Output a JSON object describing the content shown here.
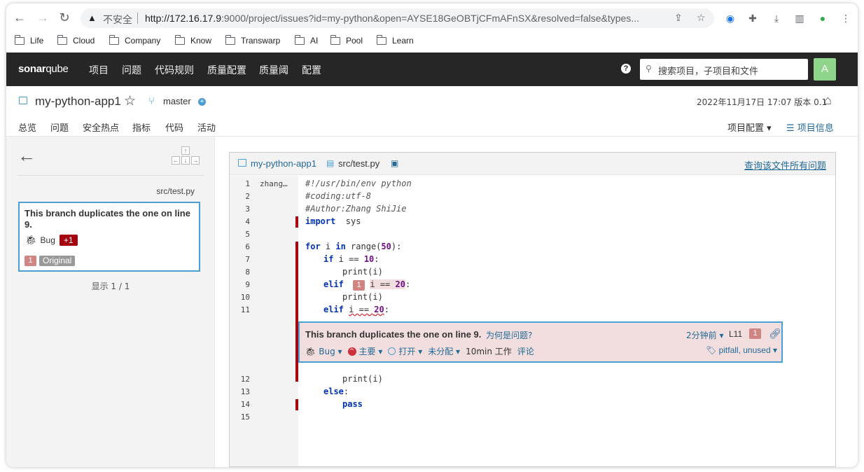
{
  "browser": {
    "insecure_label": "不安全",
    "url_host": "http://172.16.17.9",
    "url_rest": ":9000/project/issues?id=my-python&open=AYSE18GeOBTjCFmAFnSX&resolved=false&types...",
    "bookmarks": [
      "Life",
      "Cloud",
      "Company",
      "Know",
      "Transwarp",
      "AI",
      "Pool",
      "Learn"
    ]
  },
  "header": {
    "logo_bold": "sonar",
    "logo_light": "qube",
    "nav": [
      "项目",
      "问题",
      "代码规则",
      "质量配置",
      "质量阈",
      "配置"
    ],
    "help": "?",
    "search_placeholder": "搜索项目，子项目和文件",
    "avatar_letter": "A"
  },
  "project": {
    "name": "my-python-app1",
    "branch": "master",
    "branch_add": "+",
    "meta": "2022年11月17日 17:07   版本 0.1",
    "tabs": [
      "总览",
      "问题",
      "安全热点",
      "指标",
      "代码",
      "活动"
    ],
    "active_tab": "问题",
    "config_label": "项目配置 ▾",
    "info_label": "项目信息"
  },
  "sidebar": {
    "file_path": "src/test.py",
    "issue_title": "This branch duplicates the one on line 9.",
    "issue_type": "Bug",
    "issue_extra": "+1",
    "loc_number": "1",
    "loc_label": "Original",
    "count": "显示 1 / 1",
    "keys": [
      "↑",
      "←",
      "↓",
      "→"
    ]
  },
  "viewer": {
    "project": "my-python-app1",
    "file": "src/test.py",
    "all_issues_link": "查询该文件所有问题",
    "author": "zhang…",
    "line_numbers": [
      "1",
      "2",
      "3",
      "4",
      "5",
      "6",
      "7",
      "8",
      "9",
      "10",
      "11",
      "12",
      "13",
      "14",
      "15"
    ],
    "lines": {
      "l1": "#!/usr/bin/env python",
      "l2": "#coding:utf-8",
      "l3": "#Author:Zhang ShiJie",
      "l4_kw": "import",
      "l4_rest": "  sys",
      "l6_kw1": "for",
      "l6_mid": " i ",
      "l6_kw2": "in",
      "l6_a": " range(",
      "l6_num": "50",
      "l6_b": "):",
      "l7_kw": "if",
      "l7_mid": " i == ",
      "l7_num": "10",
      "l7_end": ":",
      "l8": "print(i)",
      "l9_kw": "elif",
      "l9_badge": "1",
      "l9_mid": "i == ",
      "l9_num": "20",
      "l9_end": ":",
      "l10": "print(i)",
      "l11_kw": "elif",
      "l11_mid": "i == ",
      "l11_num": "20",
      "l11_end": ":",
      "l12": "print(i)",
      "l13_kw": "else",
      "l13_end": ":",
      "l14_kw": "pass"
    },
    "issue": {
      "title": "This branch duplicates the one on line 9.",
      "why": "为何是问题?",
      "time": "2分钟前 ▾",
      "line": "L11",
      "loc_badge": "1",
      "type": "Bug ▾",
      "severity": "主要 ▾",
      "status": "打开 ▾",
      "assignee": "未分配 ▾",
      "effort": "10min 工作",
      "comment": "评论",
      "tags": "pitfall, unused ▾"
    }
  }
}
